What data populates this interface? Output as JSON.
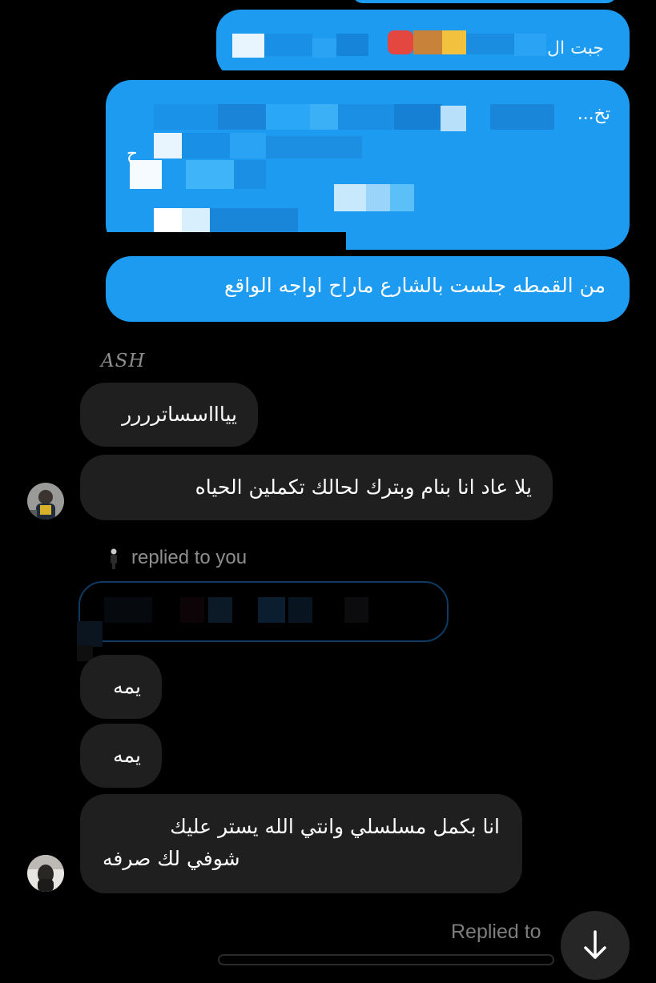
{
  "messages_out": {
    "m1_text": "جبت ال...",
    "m2_line1": "تخ...",
    "m2_line2": "ح",
    "m2_line3": "...",
    "m2_line4": "...",
    "m3_text": "من القمطه جلست بالشارع ماراح اواجه الواقع"
  },
  "sender": {
    "name": "ASH"
  },
  "messages_in": {
    "m1_text": "يياااسساترررر",
    "m2_text": "يلا عاد انا بنام وبترك لحالك تكملين الحياه",
    "reply_label": "replied to you",
    "m3_text": "يمه",
    "m4_text": "يمه",
    "m5_line1": "انا بكمل مسلسلي وانتي الله يستر عليك",
    "m5_line2": "شوفي لك صرفه"
  },
  "footer": {
    "replied_to_label": "Replied to",
    "scroll_down_icon": "arrow-down-icon"
  },
  "colors": {
    "outgoing_bubble": "#1d9bf0",
    "incoming_bubble": "#1f1f1f",
    "meta_text": "#8e8e8e"
  }
}
